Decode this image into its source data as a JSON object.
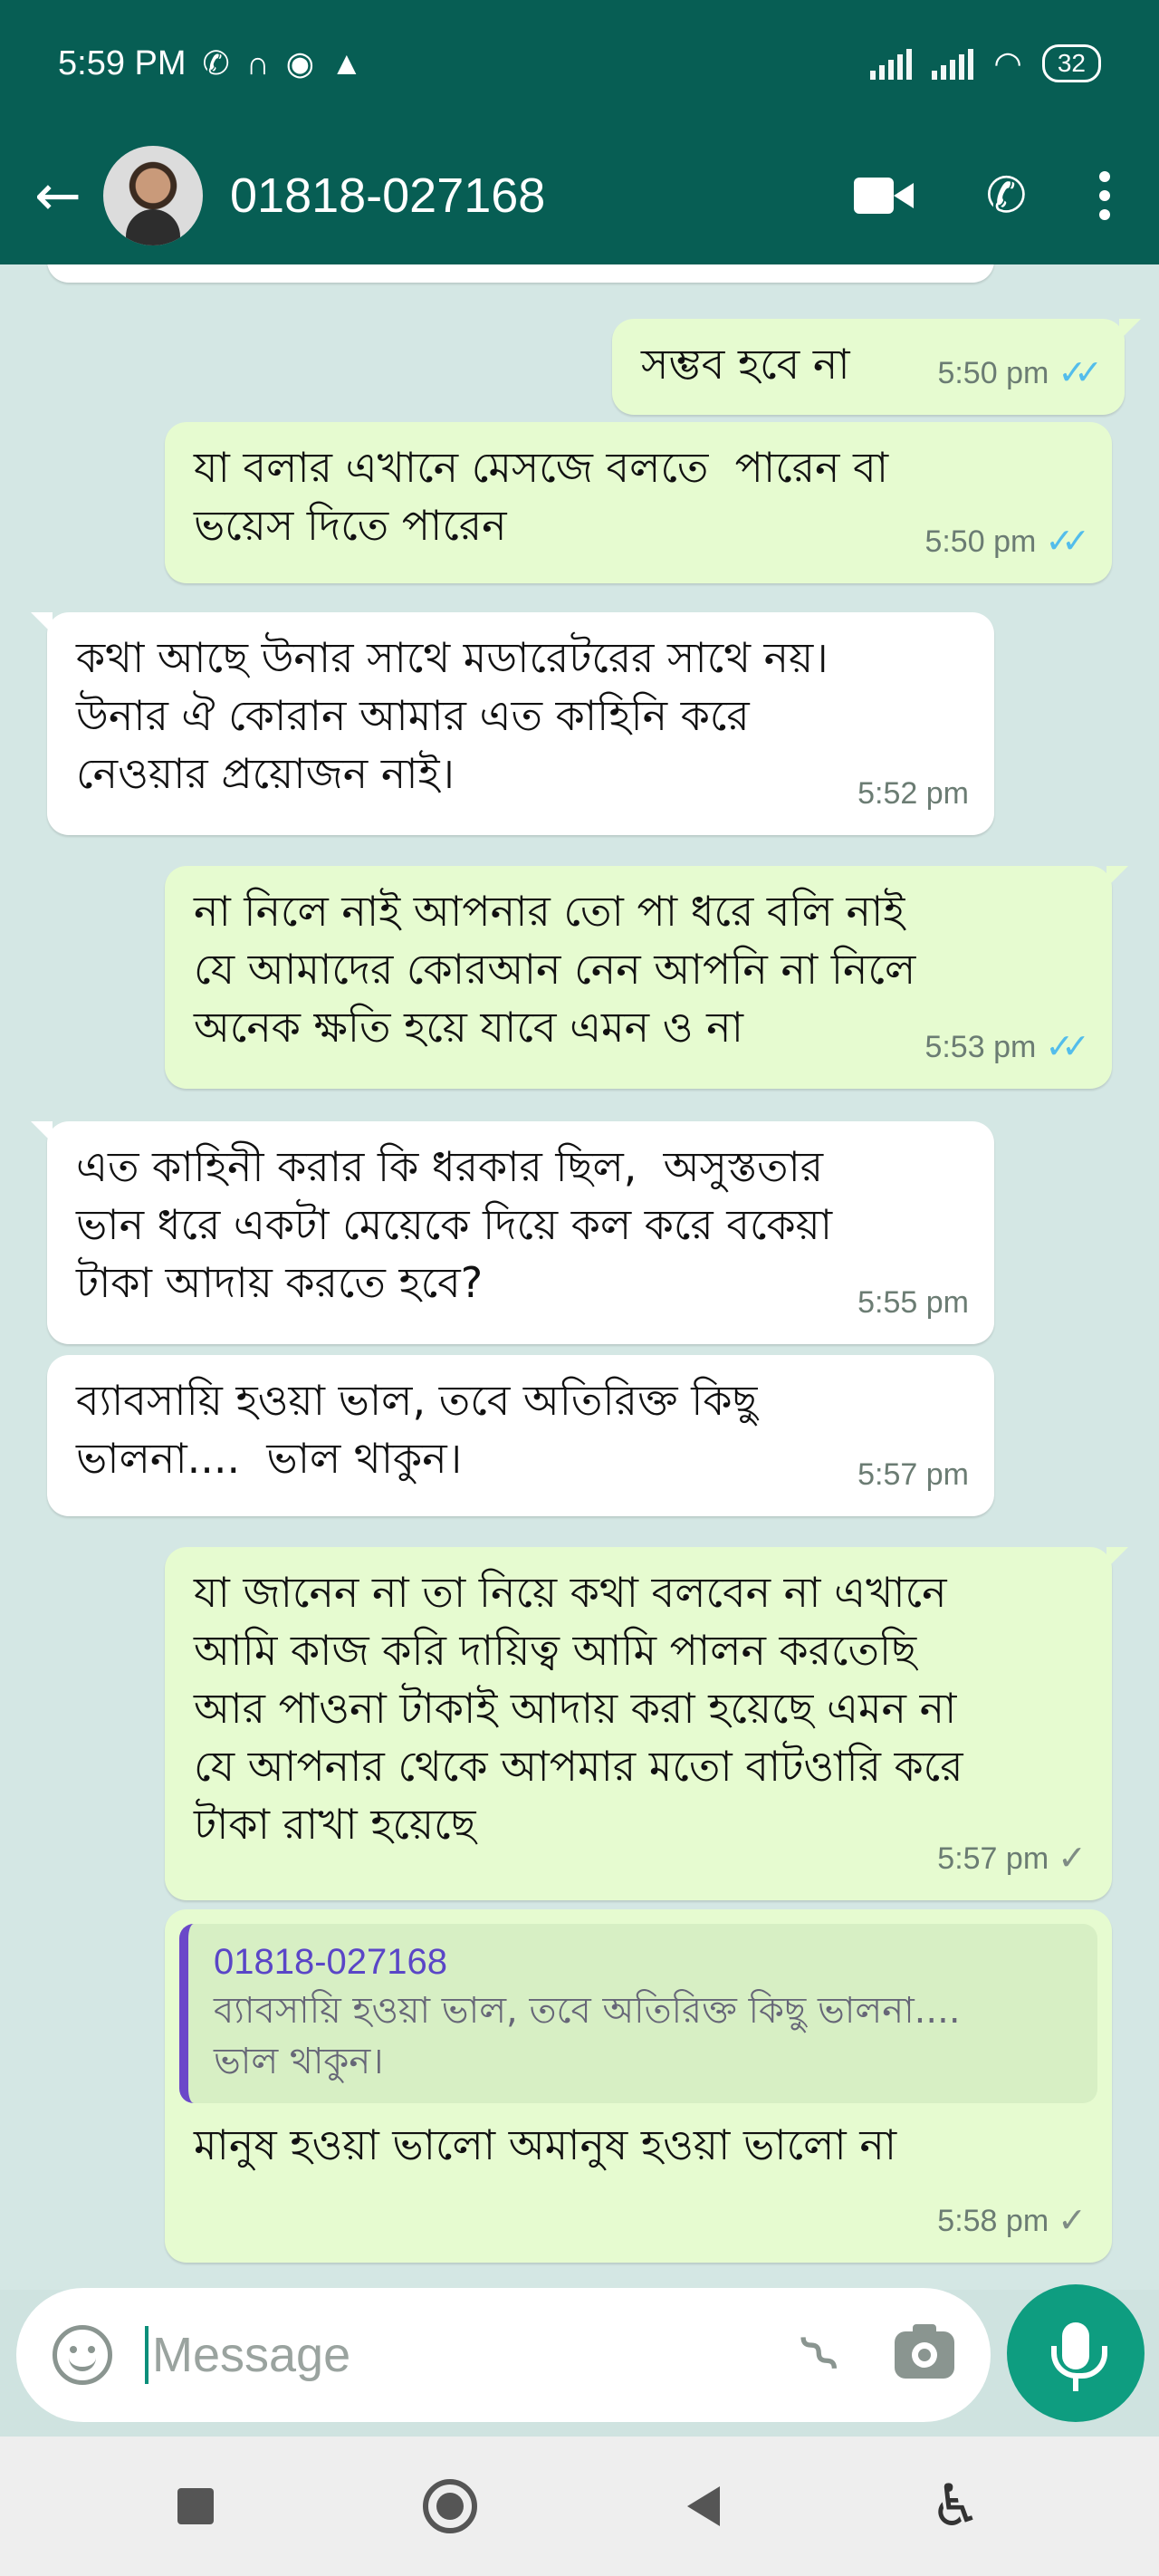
{
  "status_bar": {
    "time": "5:59 PM",
    "icons": [
      "no-wifi-call-icon",
      "headset-icon",
      "messenger-icon",
      "warning-icon"
    ],
    "battery": "32"
  },
  "header": {
    "contact_name": "01818-027168",
    "actions": [
      "video-call-icon",
      "voice-call-icon",
      "menu-icon"
    ]
  },
  "messages": [
    {
      "dir": "out",
      "text": "সম্ভব হবে না",
      "time": "5:50 pm",
      "status": "read"
    },
    {
      "dir": "out",
      "text": "যা বলার এখানে মেসজে বলতে  পারেন বা\nভয়েস দিতে পারেন",
      "time": "5:50 pm",
      "status": "read"
    },
    {
      "dir": "in",
      "text": "কথা আছে উনার সাথে মডারেটরের সাথে নয়।\nউনার ঐ কোরান আমার এত কাহিনি করে\nনেওয়ার প্রয়োজন নাই।",
      "time": "5:52 pm"
    },
    {
      "dir": "out",
      "text": "না নিলে নাই আপনার তো পা ধরে বলি নাই\nযে আমাদের কোরআন নেন আপনি না নিলে\nঅনেক ক্ষতি হয়ে যাবে এমন ও না",
      "time": "5:53 pm",
      "status": "read"
    },
    {
      "dir": "in",
      "text": "এত কাহিনী করার কি ধরকার ছিল,  অসুস্ততার\nভান ধরে একটা মেয়েকে দিয়ে কল করে বকেয়া\nটাকা আদায় করতে হবে?",
      "time": "5:55 pm"
    },
    {
      "dir": "in",
      "text": "ব্যাবসায়ি হওয়া ভাল, তবে অতিরিক্ত কিছু\nভালনা....  ভাল থাকুন।",
      "time": "5:57 pm"
    },
    {
      "dir": "out",
      "text": "যা জানেন না তা নিয়ে কথা বলবেন না এখানে\nআমি কাজ করি দায়িত্ব আমি পালন করতেছি\nআর পাওনা টাকাই আদায় করা হয়েছে এমন না\nযে আপনার থেকে আপমার মতো বাটওারি করে\nটাকা রাখা হয়েছে",
      "time": "5:57 pm",
      "status": "sent"
    },
    {
      "dir": "out",
      "quote_name": "01818-027168",
      "quote_text": "ব্যাবসায়ি হওয়া ভাল, তবে অতিরিক্ত কিছু ভালনা....\nভাল থাকুন।",
      "text": "মানুষ হওয়া ভালো অমানুষ হওয়া ভালো না",
      "time": "5:58 pm",
      "status": "sent"
    }
  ],
  "composer": {
    "placeholder": "Message"
  },
  "ticks": {
    "read": "✓✓",
    "sent": "✓"
  },
  "colors": {
    "header": "#075e54",
    "outgoing_bubble": "#e6fbd0",
    "incoming_bubble": "#ffffff",
    "read_tick": "#53bdeb",
    "mic_button": "#0e9d80"
  }
}
